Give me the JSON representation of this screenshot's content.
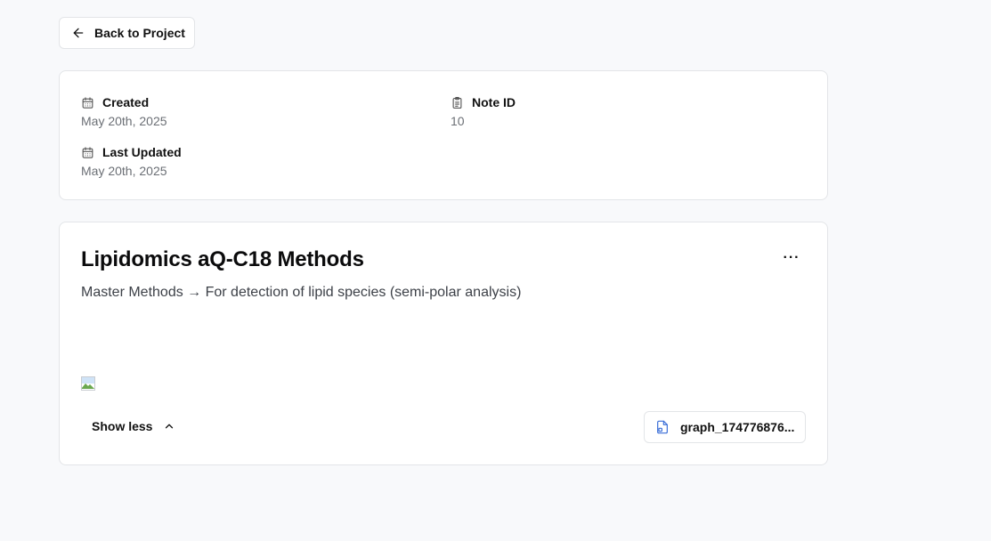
{
  "back_button": {
    "label": "Back to Project",
    "icon": "arrow-left-icon"
  },
  "meta": {
    "created": {
      "label": "Created",
      "value": "May 20th, 2025",
      "icon": "calendar-icon"
    },
    "note_id": {
      "label": "Note ID",
      "value": "10",
      "icon": "clipboard-icon"
    },
    "last_updated": {
      "label": "Last Updated",
      "value": "May 20th, 2025",
      "icon": "calendar-icon"
    }
  },
  "note": {
    "title": "Lipidomics aQ-C18 Methods",
    "description": "Master Methods → For detection of lipid species (semi-polar analysis)",
    "more_label": "···",
    "show_less_label": "Show less",
    "attachment": {
      "name": "graph_174776876...",
      "icon": "file-image-icon",
      "icon_color": "#3b6fd8"
    }
  }
}
